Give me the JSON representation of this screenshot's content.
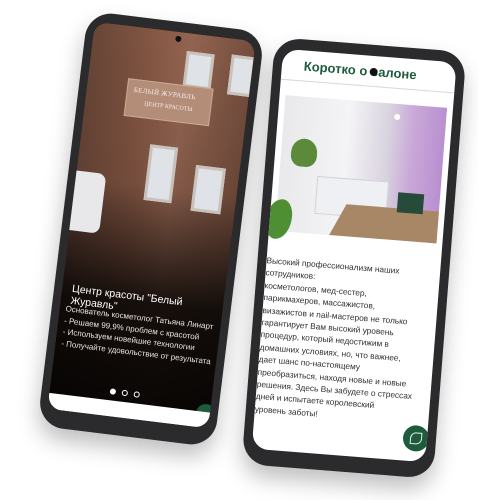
{
  "phone1": {
    "sign_line1": "БЕЛЫЙ ЖУРАВЛЬ",
    "sign_line2": "ЦЕНТР КРАСОТЫ",
    "title": "Центр красоты \"Белый Журавль\"",
    "lines": [
      "Основатель косметолог Татьяна Линарт",
      "- Решаем 99,9% проблем с красотой",
      "- Используем новейшие технологии",
      "- Получайте удовольствие от результата"
    ],
    "carousel_pages": 3,
    "carousel_active": 1
  },
  "phone2": {
    "heading": "Коротко о салоне",
    "paragraph": [
      "Высокий профессионализм наших",
      "сотрудников:",
      "косметологов, мед-сестер,",
      "парикмахеров, массажистов,",
      "визажистов и nail-мастеров не только",
      "гарантирует Вам высокий уровень",
      "процедур, который недостижим в",
      "домашних условиях, но, что важнее,",
      "дает шанс по-настоящему",
      "преобразиться, находя новые и новые",
      "решения. Здесь Вы забудете о стрессах",
      "дней и испытаете королевский",
      "уровень заботы!"
    ]
  },
  "colors": {
    "accent_green": "#1d5b3c",
    "phone_body": "#2b2b2d"
  },
  "icons": {
    "fab": "leaf-logo-icon"
  }
}
